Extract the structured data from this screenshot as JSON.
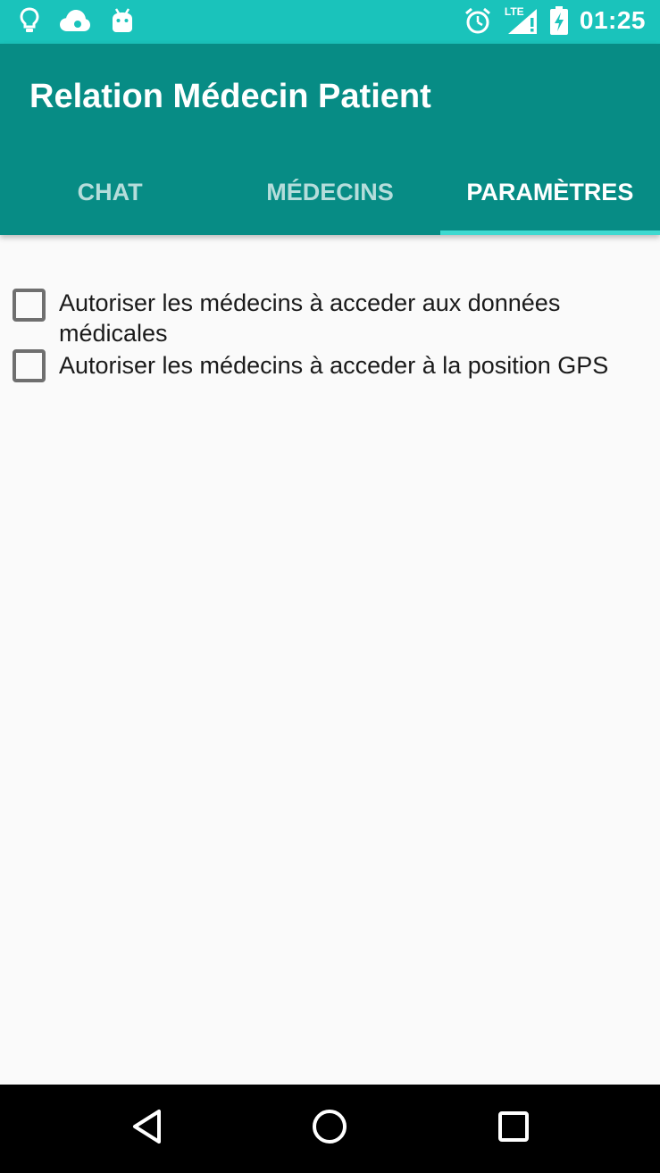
{
  "status_bar": {
    "left_icons": [
      "lightbulb-icon",
      "cloud-icon",
      "android-icon"
    ],
    "right_icons": [
      "alarm-icon",
      "lte-signal-icon",
      "battery-charging-icon"
    ],
    "lte_label": "LTE",
    "time": "01:25"
  },
  "app": {
    "title": "Relation Médecin Patient"
  },
  "tabs": [
    {
      "label": "CHAT",
      "active": false
    },
    {
      "label": "MÉDECINS",
      "active": false
    },
    {
      "label": "PARAMÈTRES",
      "active": true
    }
  ],
  "settings": {
    "options": [
      {
        "label": "Autoriser les médecins à acceder aux données médicales",
        "checked": false
      },
      {
        "label": "Autoriser les médecins à acceder à la position GPS",
        "checked": false
      }
    ]
  },
  "nav_bar": {
    "buttons": [
      "back-icon",
      "home-icon",
      "recents-icon"
    ]
  },
  "colors": {
    "status_bar": "#1ac3bb",
    "app_bar": "#078c85",
    "tab_indicator": "#3ed9d0",
    "background": "#fafafa",
    "nav_bar": "#000000"
  }
}
